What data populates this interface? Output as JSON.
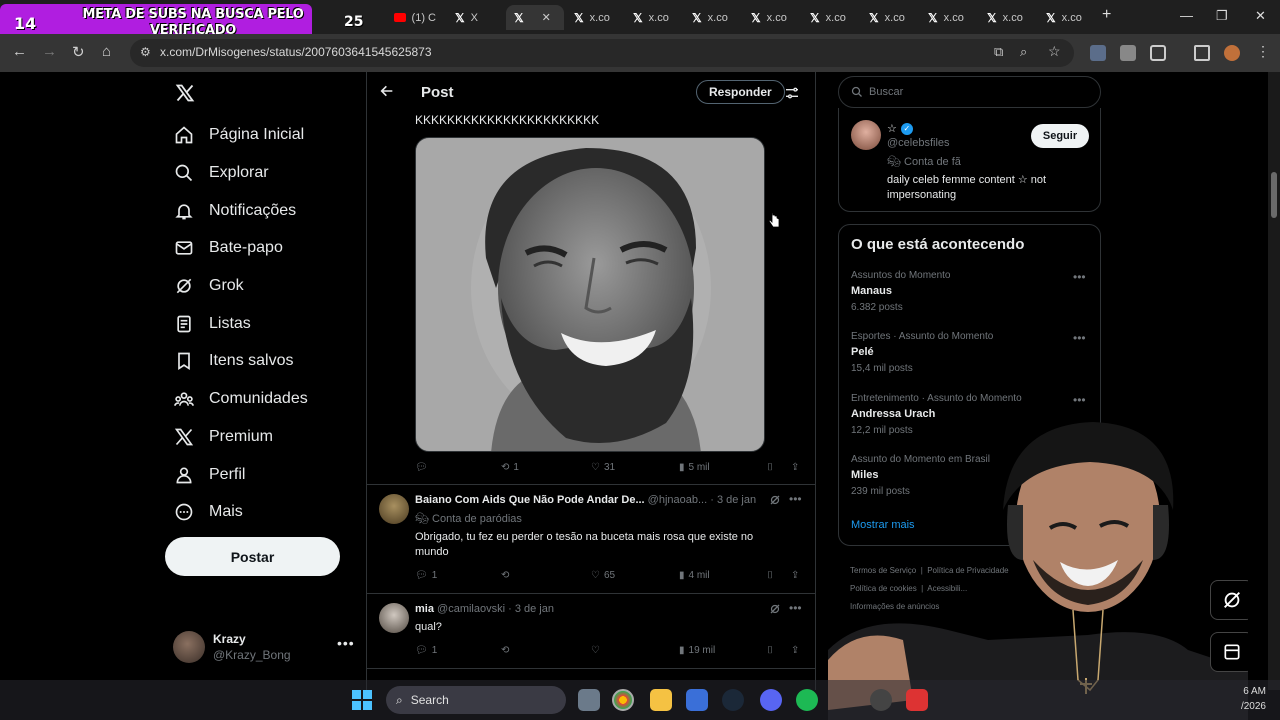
{
  "overlay": {
    "subs_count": "14",
    "message": "META DE SUBS NA BUSCA PELO VERIFICADO",
    "goal": "25"
  },
  "browser": {
    "tabs": [
      {
        "label": "(1) C"
      },
      {
        "label": "X"
      },
      {
        "label": "x.co"
      },
      {
        "label": "x.co"
      },
      {
        "label": "x.co"
      },
      {
        "label": "x.co"
      },
      {
        "label": "x.co"
      },
      {
        "label": "x.co"
      },
      {
        "label": "x.co"
      },
      {
        "label": "x.co"
      },
      {
        "label": "x.co"
      }
    ],
    "url": "x.com/DrMisogenes/status/2007603641545625873"
  },
  "nav": {
    "items": [
      {
        "label": "Página Inicial",
        "icon": "home-icon"
      },
      {
        "label": "Explorar",
        "icon": "search-icon"
      },
      {
        "label": "Notificações",
        "icon": "bell-icon"
      },
      {
        "label": "Bate-papo",
        "icon": "mail-icon"
      },
      {
        "label": "Grok",
        "icon": "grok-icon"
      },
      {
        "label": "Listas",
        "icon": "list-icon"
      },
      {
        "label": "Itens salvos",
        "icon": "bookmark-icon"
      },
      {
        "label": "Comunidades",
        "icon": "communities-icon"
      },
      {
        "label": "Premium",
        "icon": "x-logo-icon"
      },
      {
        "label": "Perfil",
        "icon": "person-icon"
      },
      {
        "label": "Mais",
        "icon": "more-circle-icon"
      }
    ],
    "post_button": "Postar",
    "account": {
      "name": "Krazy",
      "handle": "@Krazy_Bong"
    }
  },
  "main": {
    "title": "Post",
    "reply_button": "Responder",
    "tweet": {
      "text": "KKKKKKKKKKKKKKKKKKKKKKK",
      "stats": {
        "replies": "",
        "reposts": "1",
        "likes": "31",
        "views": "5 mil"
      }
    },
    "replies": [
      {
        "name": "Baiano Com Aids Que Não Pode Andar De...",
        "handle": "@hjnaoab...",
        "date": "· 3 de jan",
        "badge": "Conta de paródias",
        "text": "Obrigado, tu fez eu perder o tesão na buceta mais rosa que existe no mundo",
        "stats": {
          "replies": "1",
          "reposts": "",
          "likes": "65",
          "views": "4 mil"
        }
      },
      {
        "name": "mia",
        "handle": "@camilaovski",
        "date": "· 3 de jan",
        "badge": "",
        "text": "qual?",
        "stats": {
          "replies": "1",
          "reposts": "",
          "likes": "",
          "views": "19 mil"
        }
      }
    ]
  },
  "right": {
    "search_placeholder": "Buscar",
    "suggestion": {
      "name": "☆",
      "handle": "@celebsfiles",
      "badge": "Conta de fã",
      "bio": "daily celeb femme content ☆ not impersonating",
      "follow_label": "Seguir"
    },
    "trends_title": "O que está acontecendo",
    "trends": [
      {
        "category": "Assuntos do Momento",
        "name": "Manaus",
        "count": "6.382 posts"
      },
      {
        "category": "Esportes · Assunto do Momento",
        "name": "Pelé",
        "count": "15,4 mil posts"
      },
      {
        "category": "Entretenimento · Assunto do Momento",
        "name": "Andressa Urach",
        "count": "12,2 mil posts"
      },
      {
        "category": "Assunto do Momento em Brasil",
        "name": "Miles",
        "count": "239 mil posts"
      }
    ],
    "show_more": "Mostrar mais",
    "footer": {
      "line1a": "Termos de Serviço",
      "line1b": "Política de Privacidade",
      "line2a": "Política de cookies",
      "line2b": "Acessibili...",
      "line3": "Informações de anúncios"
    }
  },
  "taskbar": {
    "search_label": "Search",
    "time": "6 AM",
    "date": "/2026"
  }
}
